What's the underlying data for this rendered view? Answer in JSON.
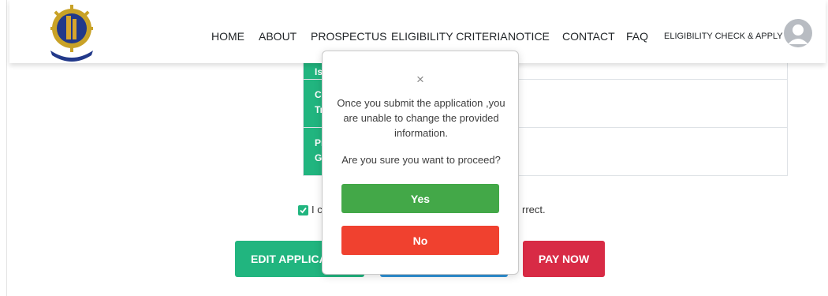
{
  "nav": {
    "items": [
      "HOME",
      "ABOUT",
      "PROSPECTUS",
      "ELIGIBILITY CRITERIA",
      "NOTICE",
      "CONTACT",
      "FAQ",
      "ELIGIBILITY CHECK & APPLY"
    ]
  },
  "table": {
    "rows": [
      {
        "label_fragment": "Is"
      },
      {
        "label_line1": "Cl",
        "label_line2": "Tr"
      },
      {
        "label_line1": "Pr",
        "label_line2": "Gr"
      }
    ]
  },
  "declaration": {
    "visible_left": "I c",
    "visible_right": "rrect."
  },
  "actions": {
    "edit_label": "EDIT APPLICA",
    "pay_label": "PAY NOW"
  },
  "modal": {
    "close_symbol": "×",
    "message": "Once you submit the application ,you are unable to change the provided information.",
    "question": "Are you sure you want to proceed?",
    "yes_label": "Yes",
    "no_label": "No"
  },
  "colors": {
    "green": "#21b57f",
    "blue": "#2f92d6",
    "red": "#d82b45",
    "yes": "#43a848",
    "no": "#f0412f"
  },
  "icons": [
    "institution-logo",
    "user-avatar-icon",
    "checkbox-checked-icon",
    "close-icon"
  ]
}
